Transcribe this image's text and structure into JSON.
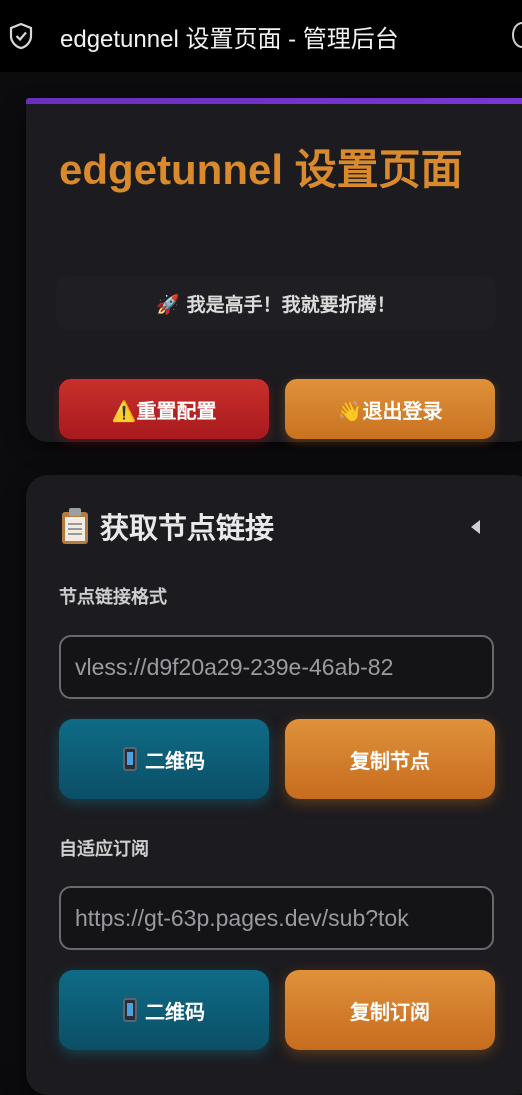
{
  "browser": {
    "tab_title": "edgetunnel 设置页面 - 管理后台"
  },
  "header_card": {
    "title": "edgetunnel 设置页面",
    "motto": "🚀 我是高手！我就要折腾！",
    "reset_button": "⚠️重置配置",
    "logout_button": "👋退出登录"
  },
  "links_card": {
    "title": "获取节点链接",
    "title_icon": "clipboard-icon",
    "node_link_label": "节点链接格式",
    "node_link_value": "vless://d9f20a29-239e-46ab-82",
    "node_qr_button": "二维码",
    "node_copy_button": "复制节点",
    "sub_label": "自适应订阅",
    "sub_value": "https://gt-63p.pages.dev/sub?tok",
    "sub_qr_button": "二维码",
    "sub_copy_button": "复制订阅"
  },
  "colors": {
    "accent_orange": "#d88a2c",
    "danger_red": "#c9302c",
    "teal": "#0f6b86",
    "purple_bar": "#6a2fc0"
  }
}
